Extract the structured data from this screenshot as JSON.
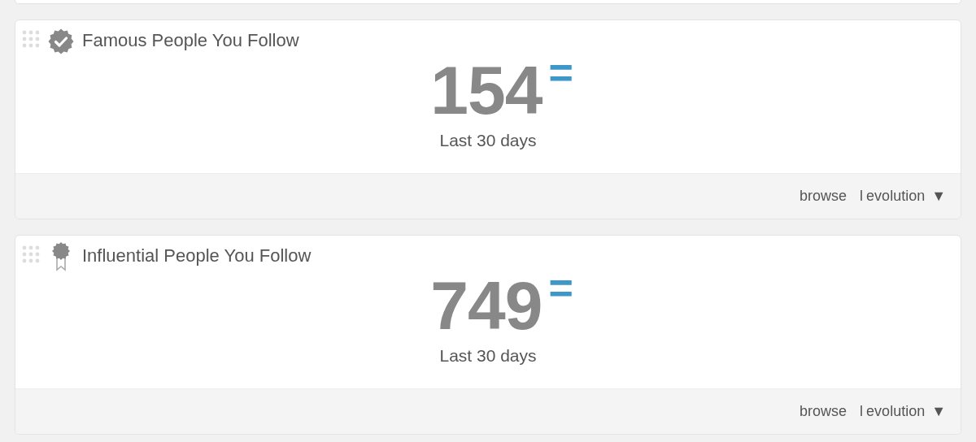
{
  "widgets": [
    {
      "title": "Famous People You Follow",
      "kind": "verified",
      "value": "154",
      "change_sign": "=",
      "period": "Last 30 days",
      "links": [
        "browse",
        "evolution"
      ],
      "separator": "l",
      "menu_caret": "▼"
    },
    {
      "title": "Influential People You Follow",
      "kind": "influential",
      "value": "749",
      "change_sign": "=",
      "period": "Last 30 days",
      "links": [
        "browse",
        "evolution"
      ],
      "separator": "l",
      "menu_caret": "▼"
    }
  ]
}
